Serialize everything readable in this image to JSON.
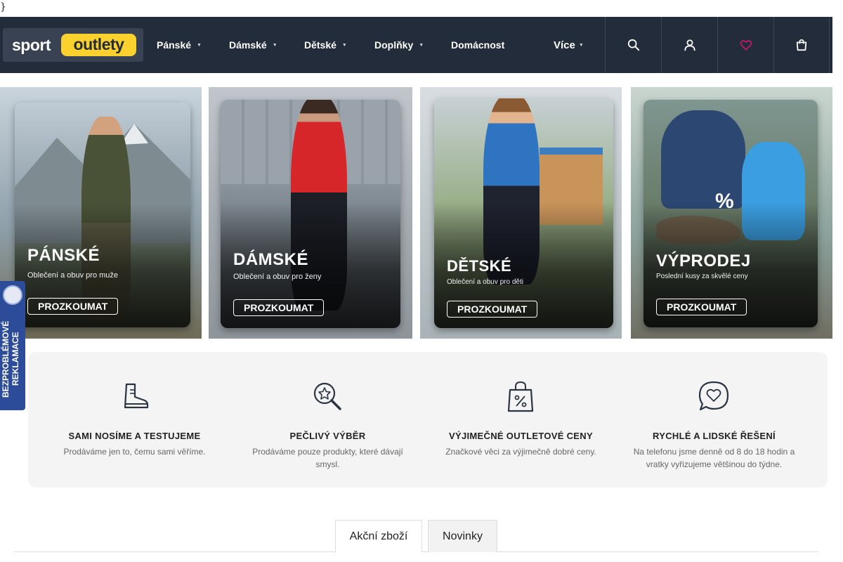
{
  "stray_text": "}",
  "header": {
    "logo": {
      "word1": "sport",
      "word2": "outlety"
    },
    "nav": [
      {
        "label": "Pánské",
        "caret": "▼"
      },
      {
        "label": "Dámské",
        "caret": "▼"
      },
      {
        "label": "Dětské",
        "caret": "▼"
      },
      {
        "label": "Doplňky",
        "caret": "▼"
      },
      {
        "label": "Domácnost"
      },
      {
        "label": "Více",
        "caret": "▼"
      }
    ],
    "icons": [
      "search-icon",
      "user-icon",
      "heart-icon",
      "cart-icon"
    ],
    "colors": {
      "bar": "#232c3b",
      "logo_accent": "#fbd12d",
      "wishlist": "#c2186b"
    }
  },
  "banners": [
    {
      "title": "PÁNSKÉ",
      "subtitle": "Oblečení a obuv pro muže",
      "cta": "PROZKOUMAT"
    },
    {
      "title": "DÁMSKÉ",
      "subtitle": "Oblečení a obuv pro ženy",
      "cta": "PROZKOUMAT"
    },
    {
      "title": "DĚTSKÉ",
      "subtitle": "Oblečení a obuv pro děti",
      "cta": "PROZKOUMAT"
    },
    {
      "title": "VÝPRODEJ",
      "subtitle": "Poslední kusy za skvělé ceny",
      "cta": "PROZKOUMAT",
      "badge": "%"
    }
  ],
  "side_badge": {
    "text": "BEZPROBLÉMOVÉ REKLAMACE"
  },
  "features": [
    {
      "icon": "boot-icon",
      "title": "SAMI NOSÍME A TESTUJEME",
      "desc": "Prodáváme jen to, čemu sami věříme."
    },
    {
      "icon": "star-magnifier-icon",
      "title": "PEČLIVÝ VÝBĚR",
      "desc": "Prodáváme pouze produkty, které dávají smysl."
    },
    {
      "icon": "discount-bag-icon",
      "title": "VÝJIMEČNÉ OUTLETOVÉ CENY",
      "desc": "Značkové věci za výjimečně dobré ceny."
    },
    {
      "icon": "heart-chat-icon",
      "title": "RYCHLÉ A LIDSKÉ ŘEŠENÍ",
      "desc": "Na telefonu jsme denně od 8 do 18 hodin a vratky vyřizujeme většinou do týdne."
    }
  ],
  "tabs": [
    {
      "label": "Akční zboží",
      "active": true
    },
    {
      "label": "Novinky",
      "active": false
    }
  ]
}
